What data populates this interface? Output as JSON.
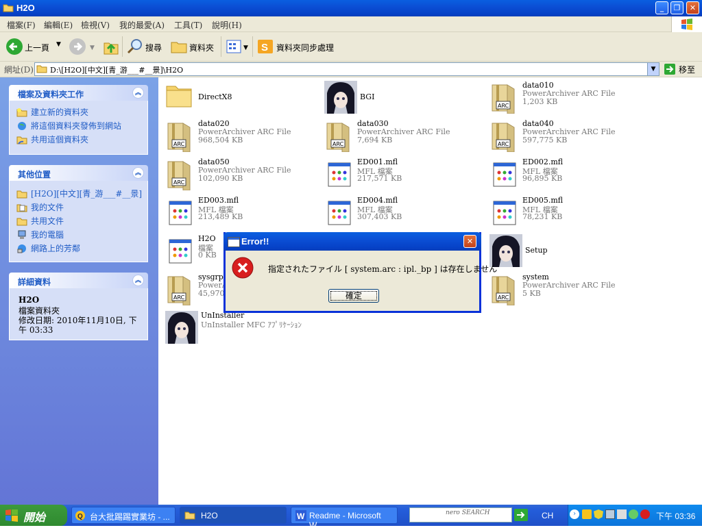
{
  "window": {
    "title": "H2O"
  },
  "menu": [
    "檔案(F)",
    "編輯(E)",
    "檢視(V)",
    "我的最愛(A)",
    "工具(T)",
    "說明(H)"
  ],
  "toolbar": {
    "back": "上一頁",
    "search": "搜尋",
    "folders": "資料夾",
    "sync": "資料夾同步處理"
  },
  "address": {
    "label": "網址(D)",
    "path": "D:\\[H2O][中文][青_游___#__景]\\H2O",
    "go": "移至"
  },
  "tasks": {
    "title": "檔案及資料夾工作",
    "items": [
      "建立新的資料夾",
      "將這個資料夾發佈到網站",
      "共用這個資料夾"
    ]
  },
  "places": {
    "title": "其他位置",
    "items": [
      "[H2O][中文][青_游___#__景]",
      "我的文件",
      "共用文件",
      "我的電腦",
      "網路上的芳鄰"
    ]
  },
  "details": {
    "title": "詳細資料",
    "name": "H2O",
    "type": "檔案資料夾",
    "modified": "修改日期: 2010年11月10日, 下午 03:33"
  },
  "files": [
    {
      "name": "DirectX8",
      "type": "",
      "size": "",
      "icon": "folder"
    },
    {
      "name": "BGI",
      "type": "",
      "size": "",
      "icon": "anime"
    },
    {
      "name": "data010",
      "type": "PowerArchiver ARC File",
      "size": "1,203 KB",
      "icon": "arc"
    },
    {
      "name": "data020",
      "type": "PowerArchiver ARC File",
      "size": "968,504 KB",
      "icon": "arc"
    },
    {
      "name": "data030",
      "type": "PowerArchiver ARC File",
      "size": "7,694 KB",
      "icon": "arc"
    },
    {
      "name": "data040",
      "type": "PowerArchiver ARC File",
      "size": "597,775 KB",
      "icon": "arc"
    },
    {
      "name": "data050",
      "type": "PowerArchiver ARC File",
      "size": "102,090 KB",
      "icon": "arc"
    },
    {
      "name": "ED001.mfl",
      "type": "MFL 檔案",
      "size": "217,571 KB",
      "icon": "mfl"
    },
    {
      "name": "ED002.mfl",
      "type": "MFL 檔案",
      "size": "96,895 KB",
      "icon": "mfl"
    },
    {
      "name": "ED003.mfl",
      "type": "MFL 檔案",
      "size": "213,489 KB",
      "icon": "mfl"
    },
    {
      "name": "ED004.mfl",
      "type": "MFL 檔案",
      "size": "307,403 KB",
      "icon": "mfl"
    },
    {
      "name": "ED005.mfl",
      "type": "MFL 檔案",
      "size": "78,231 KB",
      "icon": "mfl"
    },
    {
      "name": "H2O",
      "type": "檔案",
      "size": "0 KB",
      "icon": "mfl"
    },
    {
      "name": "",
      "type": "",
      "size": "",
      "icon": "none"
    },
    {
      "name": "Setup",
      "type": "",
      "size": "",
      "icon": "anime"
    },
    {
      "name": "sysgrp",
      "type": "PowerA",
      "size": "45,970",
      "icon": "arc"
    },
    {
      "name": "",
      "type": "",
      "size": "",
      "icon": "none"
    },
    {
      "name": "system",
      "type": "PowerArchiver ARC File",
      "size": "5 KB",
      "icon": "arc"
    },
    {
      "name": "UnInstaller",
      "type": "UnInstaller MFC ｱﾌﾟﾘｹｰｼｮﾝ",
      "size": "",
      "icon": "anime"
    }
  ],
  "dialog": {
    "title": "Error!!",
    "message": "指定されたファイル [ system.arc : ipl._bp ] は存在しません",
    "ok": "確定"
  },
  "taskbar": {
    "start": "開始",
    "items": [
      "台大批踢踢實業坊 - ...",
      "H2O",
      "Readme - Microsoft W..."
    ],
    "search_brand": "nero SEARCH",
    "lang": "CH",
    "clock": "下午 03:36"
  },
  "colors": {
    "accent": "#0a5fe0",
    "link": "#215dc6",
    "error": "#d81e1e"
  }
}
